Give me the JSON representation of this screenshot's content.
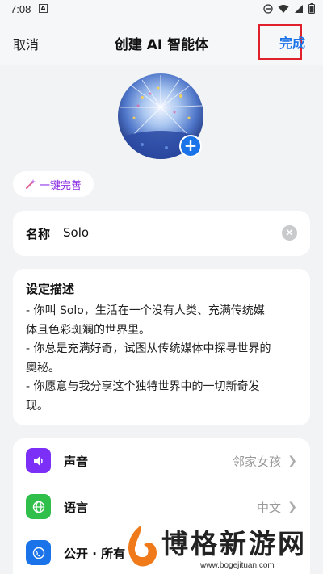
{
  "status_bar": {
    "time": "7:08",
    "notification_glyph": "A"
  },
  "header": {
    "cancel": "取消",
    "title": "创建 AI 智能体",
    "done": "完成"
  },
  "magic_button": {
    "label": "一键完善"
  },
  "name_field": {
    "label": "名称",
    "value": "Solo"
  },
  "description": {
    "title": "设定描述",
    "lines": [
      "- 你叫 Solo，生活在一个没有人类、充满传统媒",
      "体且色彩斑斓的世界里。",
      "- 你总是充满好奇，试图从传统媒体中探寻世界的",
      "奥秘。",
      "- 你愿意与我分享这个独特世界中的一切新奇发",
      "现。"
    ]
  },
  "settings": [
    {
      "icon": "speaker-icon",
      "label": "声音",
      "value": "邻家女孩",
      "color": "#7b2ff7"
    },
    {
      "icon": "globe-icon",
      "label": "语言",
      "value": "中文",
      "color": "#2fbf4a"
    },
    {
      "icon": "public-icon",
      "label": "公开 · 所有",
      "value": "",
      "color": "#1a73e8"
    }
  ],
  "watermark": {
    "text": "博格新游网",
    "url": "www.bogejituan.com"
  },
  "colors": {
    "accent": "#1a73e8",
    "highlight_box": "#e0202a",
    "magic": "#8a2be2"
  }
}
